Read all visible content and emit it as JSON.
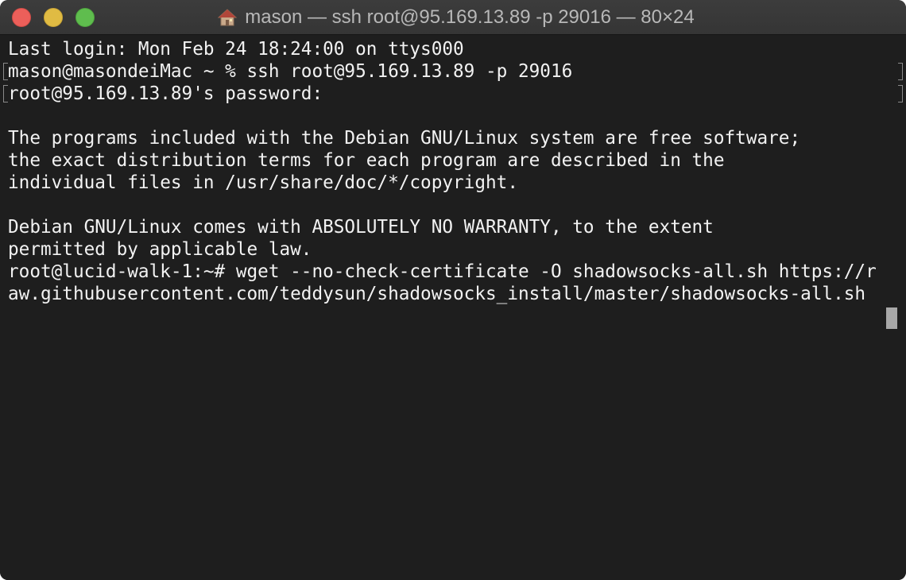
{
  "window": {
    "title": "mason — ssh root@95.169.13.89 -p 29016 — 80×24",
    "title_icon": "home-icon",
    "traffic_lights": {
      "close_color": "#ec5f5a",
      "minimize_color": "#e0bb43",
      "zoom_color": "#5fbd4e"
    }
  },
  "terminal": {
    "background": "#1e1e1e",
    "text_color": "#f2f2f2",
    "lines": [
      "Last login: Mon Feb 24 18:24:00 on ttys000",
      "mason@masondeiMac ~ % ssh root@95.169.13.89 -p 29016",
      "root@95.169.13.89's password:",
      "",
      "The programs included with the Debian GNU/Linux system are free software;",
      "the exact distribution terms for each program are described in the",
      "individual files in /usr/share/doc/*/copyright.",
      "",
      "Debian GNU/Linux comes with ABSOLUTELY NO WARRANTY, to the extent",
      "permitted by applicable law.",
      "root@lucid-walk-1:~# wget --no-check-certificate -O shadowsocks-all.sh https://r",
      "aw.githubusercontent.com/teddysun/shadowsocks_install/master/shadowsocks-all.sh"
    ]
  }
}
